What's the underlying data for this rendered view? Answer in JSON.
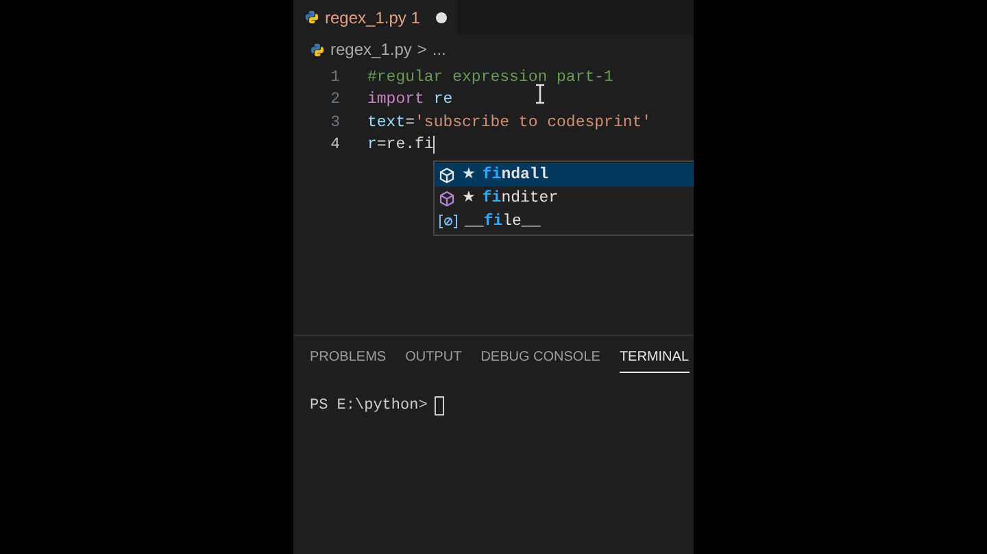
{
  "tab": {
    "label": "regex_1.py",
    "badge": "1",
    "modified": true
  },
  "breadcrumb": {
    "file": "regex_1.py",
    "separator": ">",
    "rest": "..."
  },
  "lines": [
    {
      "number": "1",
      "current": false,
      "tokens": [
        {
          "kind": "comment",
          "text": "#regular expression part-1"
        }
      ]
    },
    {
      "number": "2",
      "current": false,
      "tokens": [
        {
          "kind": "keyword",
          "text": "import "
        },
        {
          "kind": "variable",
          "text": "re"
        }
      ]
    },
    {
      "number": "3",
      "current": false,
      "tokens": [
        {
          "kind": "variable",
          "text": "text"
        },
        {
          "kind": "plain",
          "text": "="
        },
        {
          "kind": "string",
          "text": "'subscribe to codesprint'"
        }
      ]
    },
    {
      "number": "4",
      "current": true,
      "tokens": [
        {
          "kind": "variable",
          "text": "r"
        },
        {
          "kind": "plain",
          "text": "=re.fi"
        }
      ]
    }
  ],
  "suggestions": [
    {
      "kind": "method",
      "star": "★",
      "match": "fi",
      "after": "ndall",
      "selected": true
    },
    {
      "kind": "method",
      "star": "★",
      "match": "fi",
      "after": "nditer",
      "selected": false
    },
    {
      "kind": "variable",
      "before": "__",
      "match": "fi",
      "after": "le__",
      "selected": false
    }
  ],
  "panel_tabs": [
    {
      "label": "PROBLEMS",
      "selected": false
    },
    {
      "label": "OUTPUT",
      "selected": false
    },
    {
      "label": "DEBUG CONSOLE",
      "selected": false
    },
    {
      "label": "TERMINAL",
      "selected": true
    }
  ],
  "terminal": {
    "prompt": "PS E:\\python>"
  }
}
